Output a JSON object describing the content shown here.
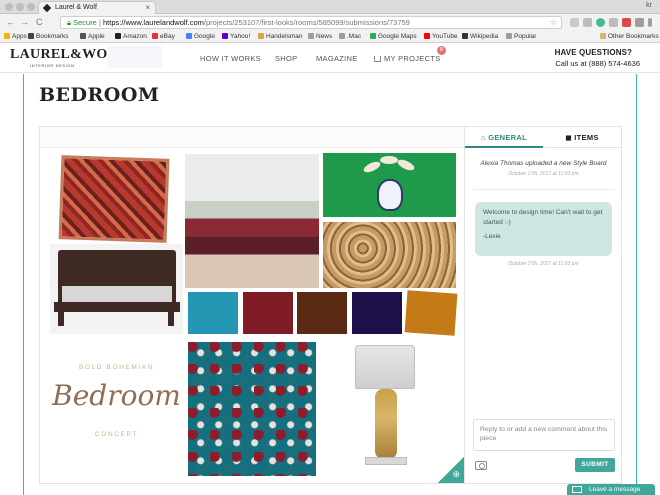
{
  "browser": {
    "tab_title": "Laurel & Wolf",
    "tab_close": "×",
    "profile": "kr",
    "back": "←",
    "forward": "→",
    "reload": "C",
    "secure_label": "Secure",
    "url_domain": "https://www.laurelandwolf.com",
    "url_path": "/projects/253107/first-looks/rooms/585099/submissions/73759",
    "star": "☆"
  },
  "bookmarks": [
    {
      "label": "Apps",
      "color": "#f4b400"
    },
    {
      "label": "Bookmarks",
      "color": "#444444"
    },
    {
      "label": "Apple",
      "color": "#555555"
    },
    {
      "label": "Amazon",
      "color": "#222222"
    },
    {
      "label": "eBay",
      "color": "#e53238"
    },
    {
      "label": "Google",
      "color": "#4285f4"
    },
    {
      "label": "Yahoo!",
      "color": "#5f01d1"
    },
    {
      "label": "Handelsman",
      "color": "#d6a44b"
    },
    {
      "label": "News",
      "color": "#9e9e9e"
    },
    {
      "label": ".Mac",
      "color": "#9e9e9e"
    },
    {
      "label": "Google Maps",
      "color": "#34a853"
    },
    {
      "label": "YouTube",
      "color": "#ff0000"
    },
    {
      "label": "Wikipedia",
      "color": "#333333"
    },
    {
      "label": "Popular",
      "color": "#9e9e9e"
    }
  ],
  "other_bookmarks": "Other Bookmarks",
  "header": {
    "logo": "LAUREL&WOLF",
    "logo_sub": "INTERIOR DESIGN",
    "nav": [
      "HOW IT WORKS",
      "SHOP",
      "MAGAZINE",
      "MY PROJECTS"
    ],
    "projects_badge": "8",
    "have_questions": "HAVE QUESTIONS?",
    "phone": "Call us at (888) 574-4636"
  },
  "page": {
    "title": "BEDROOM"
  },
  "board": {
    "concept_top": "BOLD BOHEMIAN",
    "concept_script": "Bedroom",
    "concept_bottom": "CONCEPT",
    "swatches": [
      "#2596b4",
      "#7e1b25",
      "#5a2a12",
      "#1d0f4a",
      "#c47a16"
    ],
    "zoom_icon": "⊕"
  },
  "panel": {
    "tab_general": "GENERAL",
    "tab_items": "ITEMS",
    "upload_text": "Alexia Thomas uploaded a new Style Board",
    "upload_time": "October 17th, 2017 at 11:03 pm",
    "message_lines": [
      "Welcome to design time! Can't wait to get started :-)",
      "-Lexie"
    ],
    "message_time": "October 17th, 2017 at 11:03 pm",
    "comment_placeholder": "Reply to or add a new comment about this piece",
    "submit": "SUBMIT"
  },
  "leave_message": "Leave a message"
}
